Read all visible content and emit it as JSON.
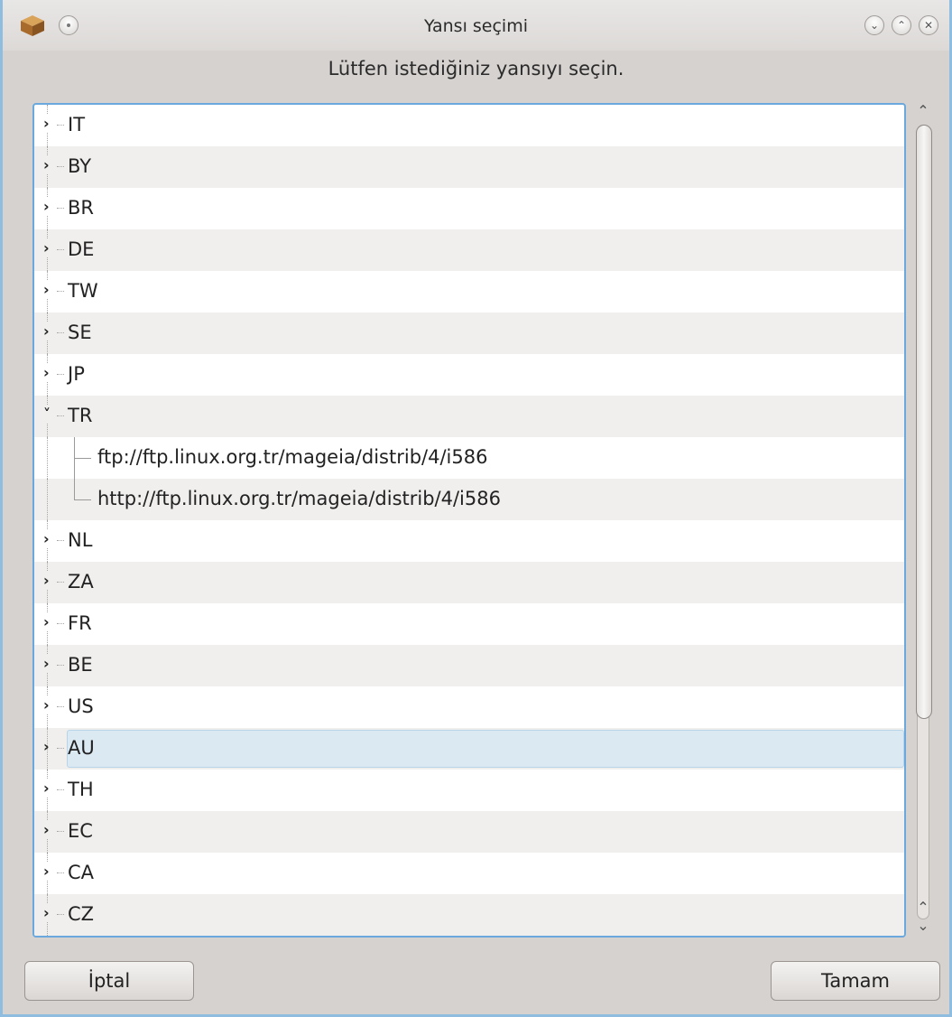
{
  "window": {
    "title": "Yansı seçimi",
    "prompt": "Lütfen istediğiniz yansıyı seçin."
  },
  "tree": {
    "selected": "AU",
    "expanded": "TR",
    "rows": [
      {
        "label": "IT",
        "kind": "collapsed"
      },
      {
        "label": "BY",
        "kind": "collapsed"
      },
      {
        "label": "BR",
        "kind": "collapsed"
      },
      {
        "label": "DE",
        "kind": "collapsed"
      },
      {
        "label": "TW",
        "kind": "collapsed"
      },
      {
        "label": "SE",
        "kind": "collapsed"
      },
      {
        "label": "JP",
        "kind": "collapsed"
      },
      {
        "label": "TR",
        "kind": "expanded"
      },
      {
        "label": "ftp://ftp.linux.org.tr/mageia/distrib/4/i586",
        "kind": "child"
      },
      {
        "label": "http://ftp.linux.org.tr/mageia/distrib/4/i586",
        "kind": "child-last"
      },
      {
        "label": "NL",
        "kind": "collapsed"
      },
      {
        "label": "ZA",
        "kind": "collapsed"
      },
      {
        "label": "FR",
        "kind": "collapsed"
      },
      {
        "label": "BE",
        "kind": "collapsed"
      },
      {
        "label": "US",
        "kind": "collapsed"
      },
      {
        "label": "AU",
        "kind": "collapsed"
      },
      {
        "label": "TH",
        "kind": "collapsed"
      },
      {
        "label": "EC",
        "kind": "collapsed"
      },
      {
        "label": "CA",
        "kind": "collapsed"
      },
      {
        "label": "CZ",
        "kind": "collapsed"
      }
    ]
  },
  "buttons": {
    "cancel": "İptal",
    "ok": "Tamam"
  },
  "titlebar": {
    "icons": [
      "package-icon",
      "menu-circle-icon",
      "minimize-icon",
      "maximize-icon",
      "close-icon"
    ]
  }
}
